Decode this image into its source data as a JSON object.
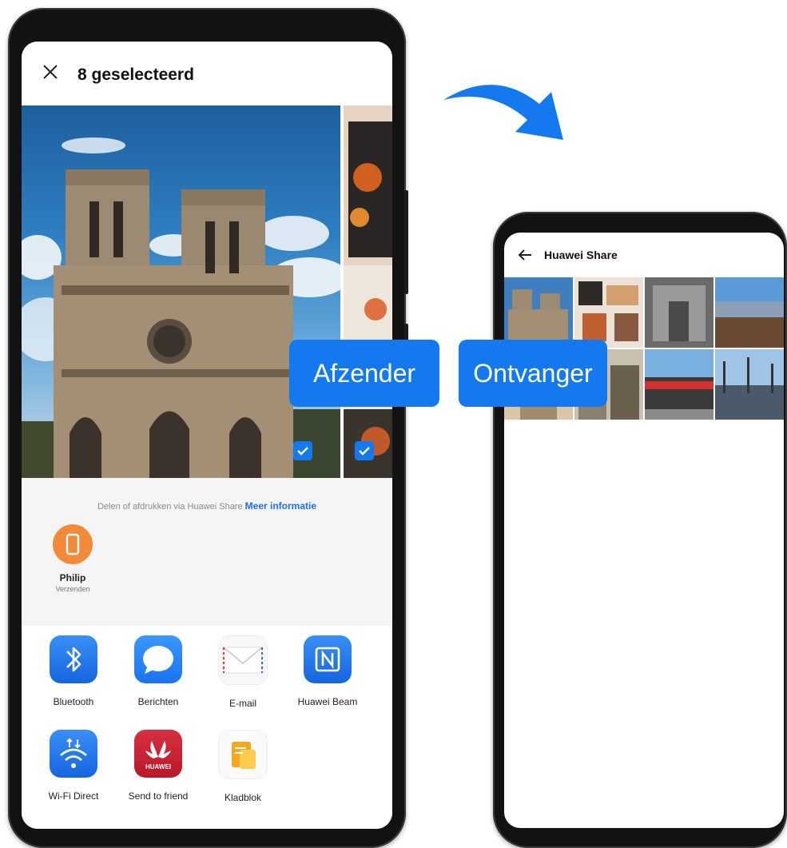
{
  "sender_screen": {
    "title": "8 geselecteerd",
    "share_info_text": "Delen of afdrukken via Huawei Share",
    "share_info_link": "Meer informatie",
    "device": {
      "name": "Philip",
      "status": "Verzenden",
      "color": "#f28a3a"
    },
    "apps": [
      {
        "label": "Bluetooth",
        "icon": "bluetooth-icon"
      },
      {
        "label": "Berichten",
        "icon": "messages-icon"
      },
      {
        "label": "E-mail",
        "icon": "email-icon"
      },
      {
        "label": "Huawei Beam",
        "icon": "nfc-icon"
      },
      {
        "label": "Wi-Fi Direct",
        "icon": "wifi-direct-icon"
      },
      {
        "label": "Send to friend",
        "icon": "huawei-icon"
      },
      {
        "label": "Kladblok",
        "icon": "notepad-icon"
      }
    ],
    "huawei_logo_text": "HUAWEI"
  },
  "receiver_screen": {
    "title": "Huawei Share"
  },
  "labels": {
    "sender": "Afzender",
    "receiver": "Ontvanger"
  },
  "colors": {
    "accent": "#1479ef",
    "link": "#1d6ff0"
  }
}
